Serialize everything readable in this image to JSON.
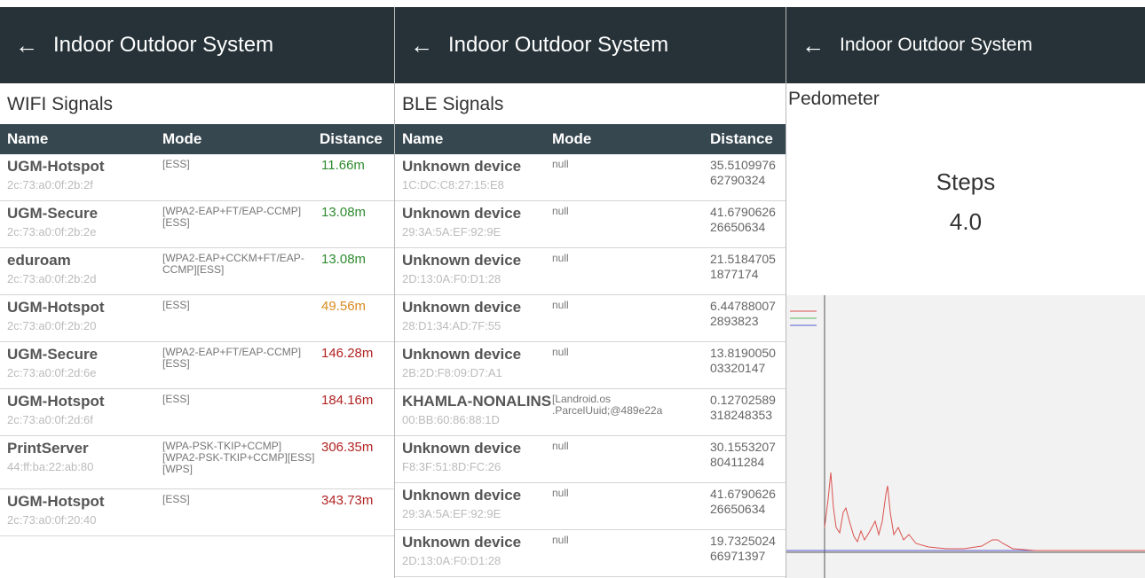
{
  "app_title": "Indoor Outdoor System",
  "wifi": {
    "section": "WIFI Signals",
    "headers": {
      "name": "Name",
      "mode": "Mode",
      "distance": "Distance"
    },
    "rows": [
      {
        "name": "UGM-Hotspot",
        "addr": "2c:73:a0:0f:2b:2f",
        "mode": "[ESS]",
        "dist": "11.66m",
        "color": "#2e8b2e"
      },
      {
        "name": "UGM-Secure",
        "addr": "2c:73:a0:0f:2b:2e",
        "mode": "[WPA2-EAP+FT/EAP-CCMP][ESS]",
        "dist": "13.08m",
        "color": "#2e8b2e"
      },
      {
        "name": "eduroam",
        "addr": "2c:73:a0:0f:2b:2d",
        "mode": "[WPA2-EAP+CCKM+FT/EAP-CCMP][ESS]",
        "dist": "13.08m",
        "color": "#2e8b2e"
      },
      {
        "name": "UGM-Hotspot",
        "addr": "2c:73:a0:0f:2b:20",
        "mode": "[ESS]",
        "dist": "49.56m",
        "color": "#d98a1c"
      },
      {
        "name": "UGM-Secure",
        "addr": "2c:73:a0:0f:2d:6e",
        "mode": "[WPA2-EAP+FT/EAP-CCMP][ESS]",
        "dist": "146.28m",
        "color": "#b22222"
      },
      {
        "name": "UGM-Hotspot",
        "addr": "2c:73:a0:0f:2d:6f",
        "mode": "[ESS]",
        "dist": "184.16m",
        "color": "#b22222"
      },
      {
        "name": "PrintServer",
        "addr": "44:ff:ba:22:ab:80",
        "mode": "[WPA-PSK-TKIP+CCMP][WPA2-PSK-TKIP+CCMP][ESS][WPS]",
        "dist": "306.35m",
        "color": "#b22222"
      },
      {
        "name": "UGM-Hotspot",
        "addr": "2c:73:a0:0f:20:40",
        "mode": "[ESS]",
        "dist": "343.73m",
        "color": "#b22222"
      }
    ]
  },
  "ble": {
    "section": "BLE Signals",
    "headers": {
      "name": "Name",
      "mode": "Mode",
      "distance": "Distance"
    },
    "rows": [
      {
        "name": "Unknown device",
        "addr": "1C:DC:C8:27:15:E8",
        "mode": "null",
        "dist": "35.5109976\n62790324"
      },
      {
        "name": "Unknown device",
        "addr": "29:3A:5A:EF:92:9E",
        "mode": "null",
        "dist": "41.6790626\n26650634"
      },
      {
        "name": "Unknown device",
        "addr": "2D:13:0A:F0:D1:28",
        "mode": "null",
        "dist": "21.5184705\n1877174"
      },
      {
        "name": "Unknown device",
        "addr": "28:D1:34:AD:7F:55",
        "mode": "null",
        "dist": "6.44788007\n2893823"
      },
      {
        "name": "Unknown device",
        "addr": "2B:2D:F8:09:D7:A1",
        "mode": "null",
        "dist": "13.8190050\n03320147"
      },
      {
        "name": "KHAMLA-NONALINS",
        "addr": "00:BB:60:86:88:1D",
        "mode": "[Landroid.os\n.ParcelUuid;@489e22a",
        "dist": "0.12702589\n318248353"
      },
      {
        "name": "Unknown device",
        "addr": "F8:3F:51:8D:FC:26",
        "mode": "null",
        "dist": "30.1553207\n80411284"
      },
      {
        "name": "Unknown device",
        "addr": "29:3A:5A:EF:92:9E",
        "mode": "null",
        "dist": "41.6790626\n26650634"
      },
      {
        "name": "Unknown device",
        "addr": "2D:13:0A:F0:D1:28",
        "mode": "null",
        "dist": "19.7325024\n66971397"
      }
    ]
  },
  "pedometer": {
    "section": "Pedometer",
    "steps_label": "Steps",
    "steps_value": "4.0",
    "graph_colors": {
      "x": "#d9534f",
      "y": "#5cb85c",
      "z": "#5b5bd6"
    }
  }
}
